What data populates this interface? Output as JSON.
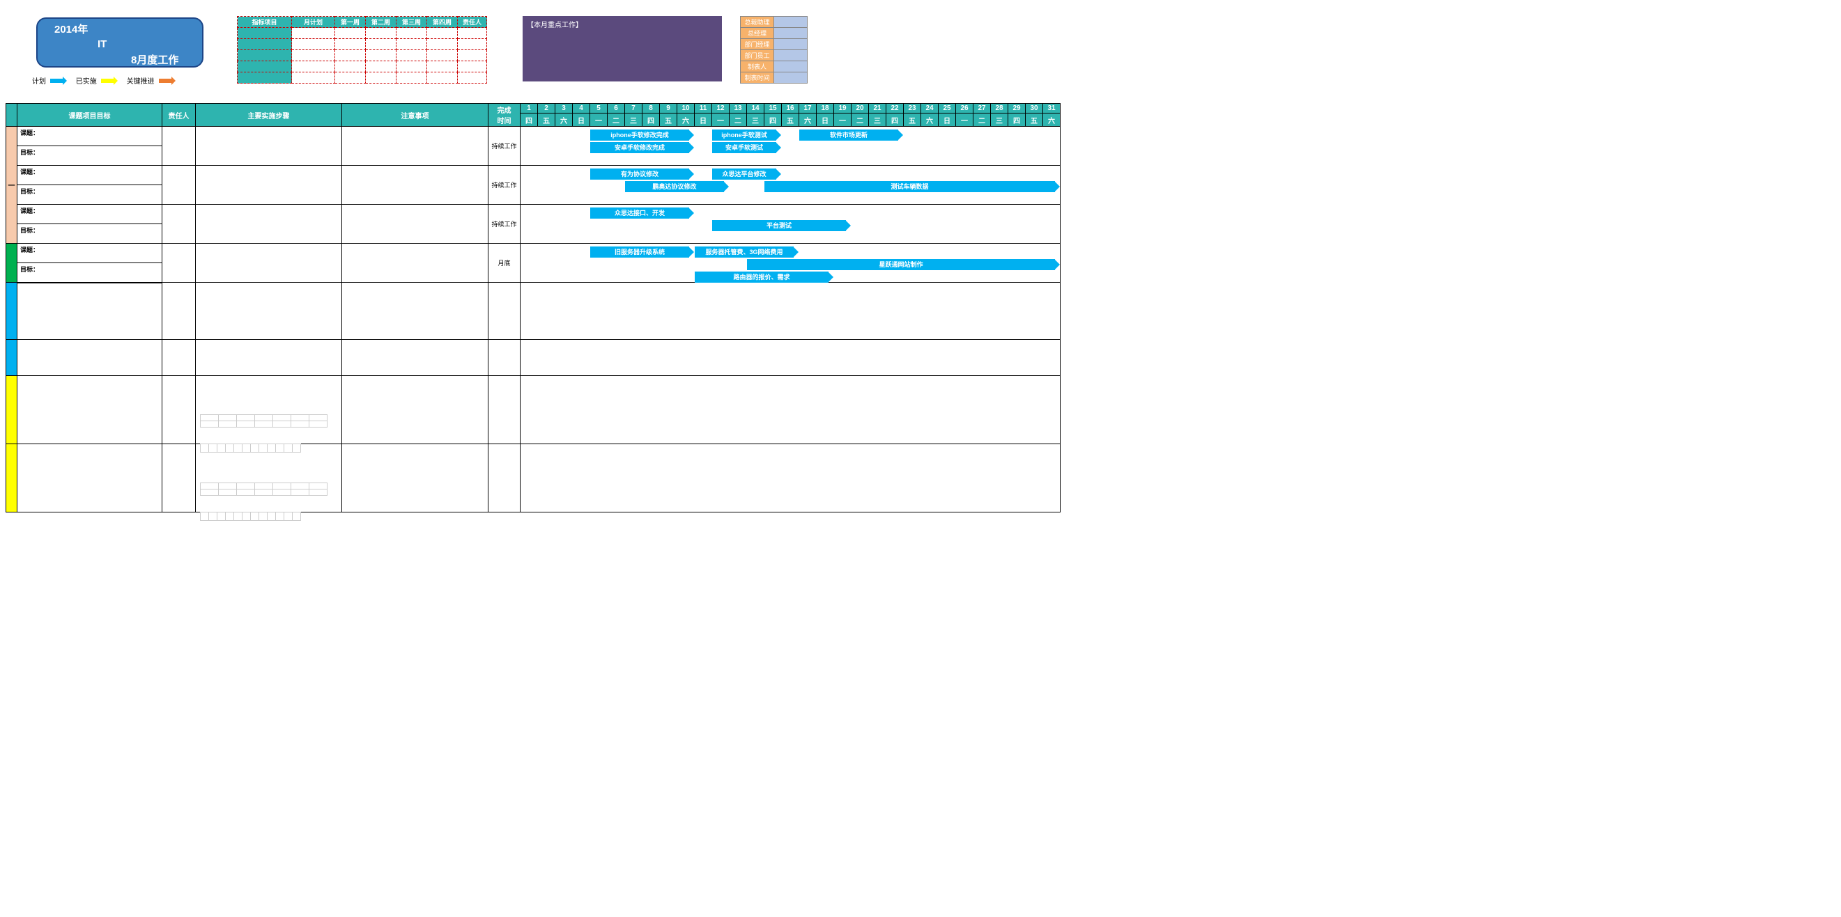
{
  "title": {
    "year": "2014年",
    "dept": "IT",
    "month_work": "8月度工作"
  },
  "legend": {
    "plan": "计划",
    "done": "已实施",
    "key": "关键推进"
  },
  "kpi_headers": [
    "指标项目",
    "月计划",
    "第一周",
    "第二周",
    "第三周",
    "第四周",
    "责任人"
  ],
  "focus_title": "【本月重点工作】",
  "roles": [
    "总裁助理",
    "总经理",
    "部门经理",
    "部门员工",
    "制表人",
    "制表时间"
  ],
  "main_headers": {
    "topic": "课题项目目标",
    "owner": "责任人",
    "steps": "主要实施步骤",
    "notes": "注意事项",
    "done": "完成\n时间"
  },
  "row_group_1": "一",
  "topic_labels": {
    "topic": "课题：",
    "goal": "目标："
  },
  "done_vals": {
    "cont": "持续工作",
    "month_end": "月底"
  },
  "days": [
    1,
    2,
    3,
    4,
    5,
    6,
    7,
    8,
    9,
    10,
    11,
    12,
    13,
    14,
    15,
    16,
    17,
    18,
    19,
    20,
    21,
    22,
    23,
    24,
    25,
    26,
    27,
    28,
    29,
    30,
    31
  ],
  "dnames": [
    "四",
    "五",
    "六",
    "日",
    "一",
    "二",
    "三",
    "四",
    "五",
    "六",
    "日",
    "一",
    "二",
    "三",
    "四",
    "五",
    "六",
    "日",
    "一",
    "二",
    "三",
    "四",
    "五",
    "六",
    "日",
    "一",
    "二",
    "三",
    "四",
    "五",
    "六"
  ],
  "chart_data": [
    {
      "type": "gantt",
      "row": 0,
      "bars": [
        {
          "label": "iphone手软修改完成",
          "start": 5,
          "end": 10
        },
        {
          "label": "安卓手软修改完成",
          "start": 5,
          "end": 10,
          "y": 1
        },
        {
          "label": "iphone手软测试",
          "start": 12,
          "end": 15
        },
        {
          "label": "安卓手软测试",
          "start": 12,
          "end": 15,
          "y": 1
        },
        {
          "label": "软件市场更新",
          "start": 17,
          "end": 22
        }
      ]
    },
    {
      "type": "gantt",
      "row": 1,
      "bars": [
        {
          "label": "有为协议修改",
          "start": 5,
          "end": 10
        },
        {
          "label": "鹏奥达协议修改",
          "start": 7,
          "end": 12,
          "y": 1
        },
        {
          "label": "众思达平台修改",
          "start": 12,
          "end": 15
        },
        {
          "label": "测试车辆数据",
          "start": 15,
          "end": 31,
          "y": 1
        }
      ]
    },
    {
      "type": "gantt",
      "row": 2,
      "bars": [
        {
          "label": "众思达接口、开发",
          "start": 5,
          "end": 10
        },
        {
          "label": "平台测试",
          "start": 12,
          "end": 19,
          "y": 1
        }
      ]
    },
    {
      "type": "gantt",
      "row": 3,
      "bars": [
        {
          "label": "旧服务器升级系统",
          "start": 5,
          "end": 10
        },
        {
          "label": "服务器托管费、3G网络费用",
          "start": 11,
          "end": 16
        },
        {
          "label": "星跃通网站制作",
          "start": 14,
          "end": 31,
          "y": 1
        },
        {
          "label": "路由器的报价、需求",
          "start": 11,
          "end": 18,
          "y": 2
        }
      ]
    }
  ]
}
